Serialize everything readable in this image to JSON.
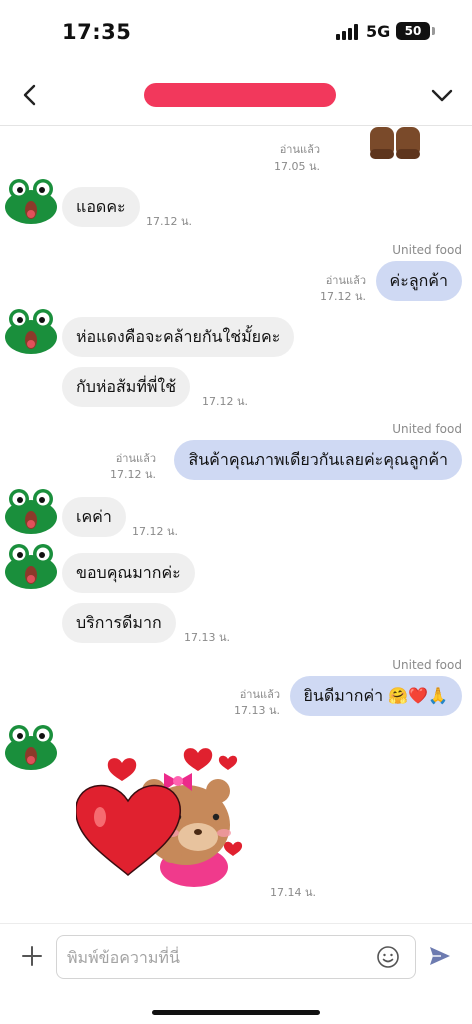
{
  "status_bar": {
    "time": "17:35",
    "network": "5G",
    "battery": "50"
  },
  "header": {
    "back_icon": "chevron-left-icon",
    "menu_icon": "chevron-down-icon"
  },
  "messages": [
    {
      "dir": "out",
      "read": "อ่านแล้ว",
      "time": "17.05 น.",
      "kind": "sticker"
    },
    {
      "dir": "in",
      "text": "แอดคะ",
      "time": "17.12 น."
    },
    {
      "dir": "out",
      "sender": "United food",
      "text": "ค่ะลูกค้า",
      "read": "อ่านแล้ว",
      "time": "17.12 น."
    },
    {
      "dir": "in",
      "text": "ห่อแดงคือจะคล้ายกันใช่มั้ยคะ"
    },
    {
      "dir": "in",
      "text": "กับห่อส้มที่พี่ใช้",
      "time": "17.12 น."
    },
    {
      "dir": "out",
      "sender": "United food",
      "text": "สินค้าคุณภาพเดียวกันเลยค่ะคุณลูกค้า",
      "read": "อ่านแล้ว",
      "time": "17.12 น."
    },
    {
      "dir": "in",
      "text": "เคค่า",
      "time": "17.12 น."
    },
    {
      "dir": "in",
      "text": "ขอบคุณมากค่ะ"
    },
    {
      "dir": "in",
      "text": "บริการดีมาก",
      "time": "17.13 น."
    },
    {
      "dir": "out",
      "sender": "United food",
      "text": "ยินดีมากค่า 🤗❤️🙏",
      "read": "อ่านแล้ว",
      "time": "17.13 น."
    },
    {
      "dir": "in",
      "kind": "sticker",
      "time": "17.14 น."
    }
  ],
  "input": {
    "placeholder": "พิมพ์ข้อความที่นี่"
  },
  "colors": {
    "out_bubble": "#cfd9f3",
    "in_bubble": "#efefef",
    "redaction": "#f2385c",
    "avatar": "#1a8f3c"
  }
}
